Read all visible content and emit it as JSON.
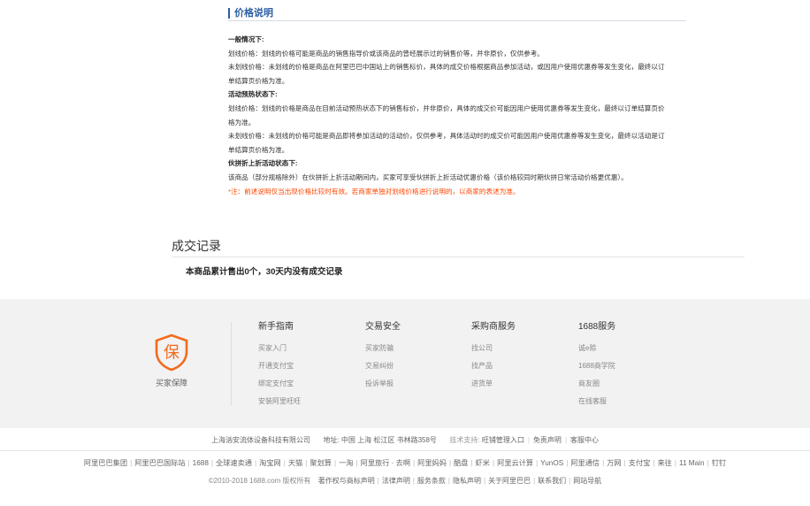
{
  "price": {
    "title": "价格说明",
    "general_heading": "一般情况下:",
    "general_p1": "划线价格：划线的价格可能是商品的销售指导价或该商品的曾经展示过的销售价等，并非原价，仅供参考。",
    "general_p2a": "未划线价格：未划线的价格是商品在阿里巴巴中国站上的销售标价，具体的成交价格根据商品参加活动，或因用户使用优惠券等发生变化，最终以订",
    "general_p2b": "单结算页价格为准。",
    "preheat_heading": "活动预热状态下:",
    "preheat_p1a": "划线价格：划线的价格是商品在目前活动预热状态下的销售标价，并非原价，具体的成交价可能因用户使用优惠券等发生变化，最终以订单结算页价",
    "preheat_p1b": "格为准。",
    "preheat_p2a": "未划线价格：未划线的价格可能是商品即将参加活动的活动价，仅供参考，具体活动时的成交价可能因用户使用优惠券等发生变化，最终以活动是订",
    "preheat_p2b": "单结算页价格为准。",
    "group_heading": "伙拼折上折活动状态下:",
    "group_p1": "该商品（部分规格除外）在伙拼折上折活动期间内，买家可享受伙拼折上折活动优惠价格（该价格较同时期伙拼日常活动价格更优惠）。",
    "note": "*注：前述说明仅当出现价格比较时有效。若商家单独对划线价格进行说明的，以商家的表述为准。"
  },
  "records": {
    "title": "成交记录",
    "summary": "本商品累计售出0个，30天内没有成交记录"
  },
  "guarantee": {
    "icon_char": "保",
    "label": "买家保障",
    "color": "#f26b1d"
  },
  "service_columns": [
    {
      "heading": "新手指南",
      "items": [
        "买家入门",
        "开通支付宝",
        "绑定支付宝",
        "安装阿里旺旺"
      ]
    },
    {
      "heading": "交易安全",
      "items": [
        "买家防骗",
        "交易纠纷",
        "投诉举报"
      ]
    },
    {
      "heading": "采购商服务",
      "items": [
        "找公司",
        "找产品",
        "进货单"
      ]
    },
    {
      "heading": "1688服务",
      "items": [
        "诚e赊",
        "1688商学院",
        "商友圈",
        "在线客服"
      ]
    }
  ],
  "company": {
    "name": "上海汹安流体设备科技有限公司",
    "address_label": "地址:",
    "address": "中国 上海 松江区 书林路358号",
    "support_label": "技术支持:",
    "links": [
      "旺铺管理入口",
      "免责声明",
      "客服中心"
    ]
  },
  "site_links": [
    "阿里巴巴集团",
    "阿里巴巴国际站",
    "1688",
    "全球速卖通",
    "淘宝网",
    "天猫",
    "聚划算",
    "一淘",
    "阿里旅行 · 去啊",
    "阿里妈妈",
    "酷盘",
    "虾米",
    "阿里云计算",
    "YunOS",
    "阿里通信",
    "万网",
    "支付宝",
    "来往",
    "11 Main",
    "钉钉"
  ],
  "copyright": "©2010-2018 1688.com 版权所有",
  "legal_links": [
    "著作权与商标声明",
    "法律声明",
    "服务条款",
    "隐私声明",
    "关于阿里巴巴",
    "联系我们",
    "网站导航"
  ]
}
